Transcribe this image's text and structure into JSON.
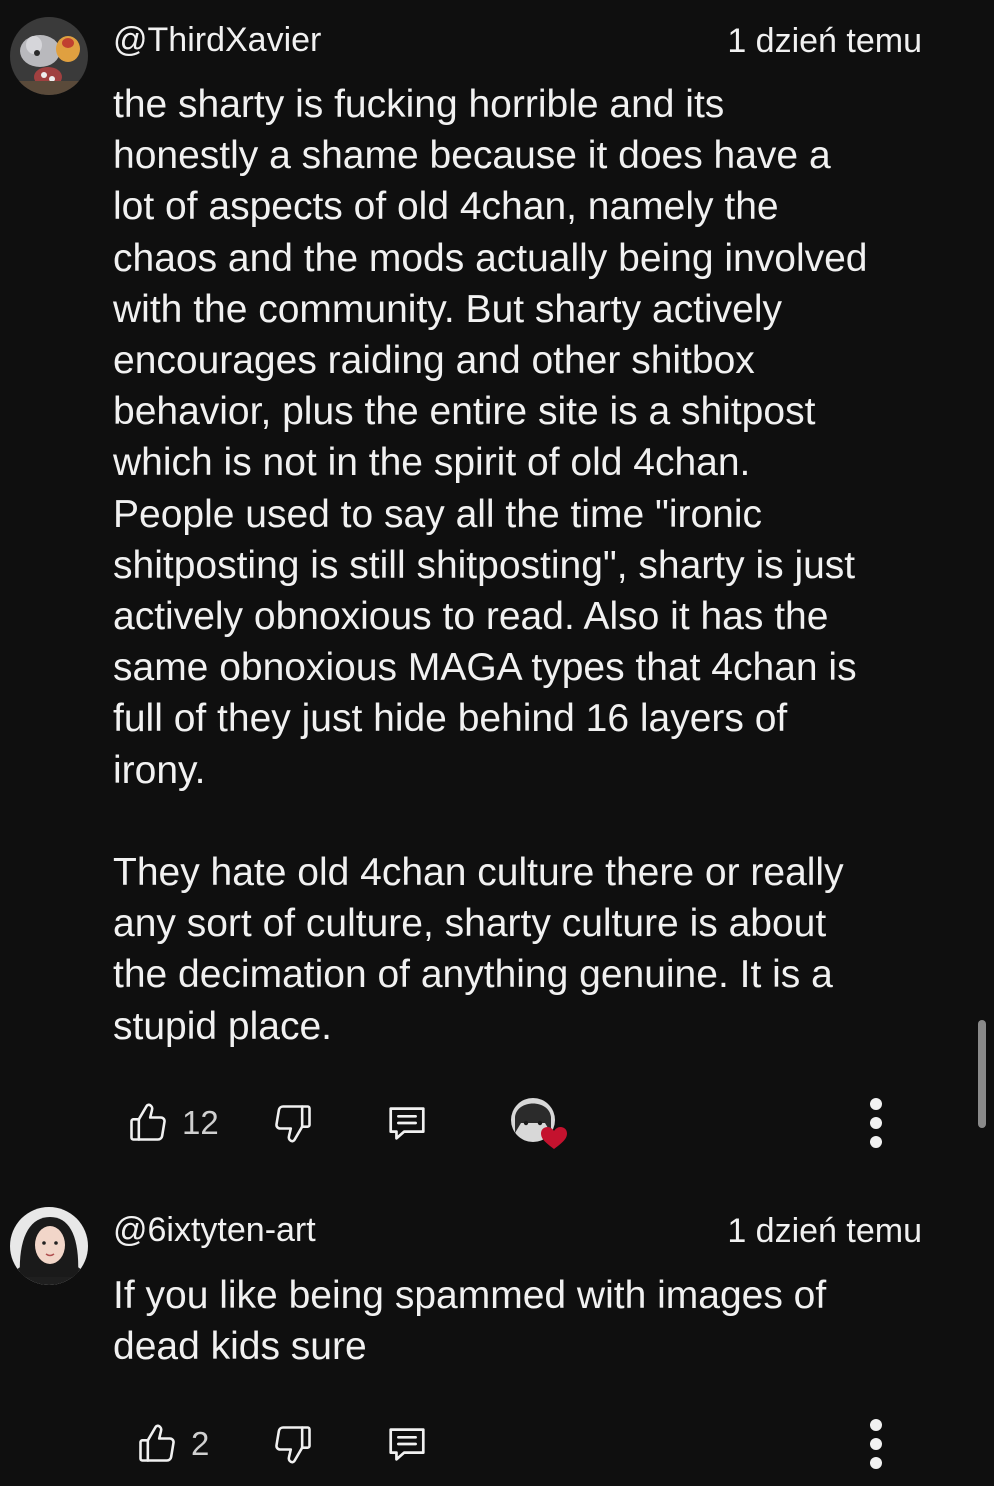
{
  "comments": [
    {
      "author": "@ThirdXavier",
      "timestamp": "1 dzień temu",
      "avatar_icon": "plush-toys-avatar",
      "text_lines_p1": [
        "the sharty is fucking horrible and its",
        "honestly a shame because it does have a",
        "lot of aspects of old 4chan, namely the",
        "chaos and the mods actually being involved",
        "with the community. But sharty actively",
        "encourages raiding and other shitbox",
        "behavior, plus the entire site is a shitpost",
        "which is not in the spirit of old 4chan.",
        "People used to say all the time \"ironic",
        "shitposting is still shitposting\", sharty is just",
        "actively obnoxious to read. Also it has the",
        "same obnoxious MAGA types that 4chan is",
        "full of they just hide behind 16 layers of",
        "irony."
      ],
      "text_lines_p2": [
        "They hate old 4chan culture there or really",
        "any sort of culture, sharty culture is about",
        "the decimation of anything genuine. It is a",
        "stupid place."
      ],
      "like_count": "12",
      "creator_heart": true
    },
    {
      "author": "@6ixtyten-art",
      "timestamp": "1 dzień temu",
      "avatar_icon": "portrait-avatar",
      "text_lines_p1": [
        "If you like being spammed with images of",
        "dead kids sure"
      ],
      "like_count": "2",
      "creator_heart": false
    }
  ],
  "icons": {
    "like": "thumbs-up-icon",
    "dislike": "thumbs-down-icon",
    "reply": "reply-icon",
    "more": "more-vertical-icon",
    "heart": "creator-heart-icon"
  },
  "colors": {
    "background": "#0f0f0f",
    "text": "#f1f1f1",
    "heart": "#c4122e"
  }
}
